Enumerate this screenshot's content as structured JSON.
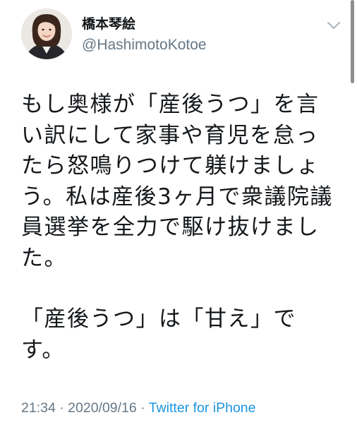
{
  "tweet": {
    "author": {
      "display_name": "橋本琴絵",
      "handle": "@HashimotoKotoe"
    },
    "paragraphs": [
      "もし奥様が「産後うつ」を言い訳にして家事や育児を怠ったら怒鳴りつけて躾けましょう。私は産後3ヶ月で衆議院議員選挙を全力で駆け抜けました。",
      "「産後うつ」は「甘え」です。"
    ],
    "time": "21:34",
    "date_separator": "·",
    "date": "2020/09/16",
    "source_separator": "·",
    "source": "Twitter for iPhone"
  },
  "icons": {
    "caret": "chevron-down-icon",
    "avatar": "profile-photo"
  },
  "colors": {
    "text": "#14171a",
    "secondary": "#657786",
    "link": "#1b95e0",
    "background": "#ffffff"
  }
}
